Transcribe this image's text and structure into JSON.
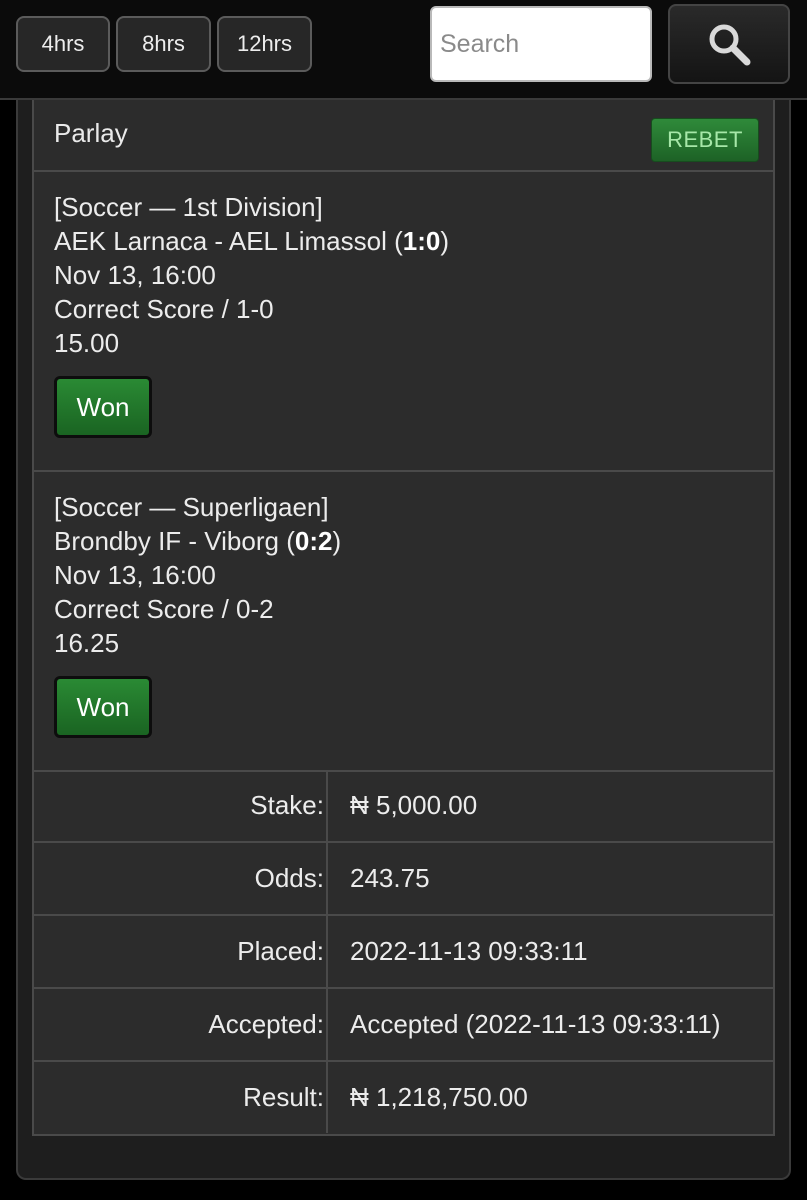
{
  "filters": {
    "buttons": [
      "4hrs",
      "8hrs",
      "12hrs"
    ]
  },
  "search": {
    "placeholder": "Search",
    "icon": "search-icon"
  },
  "bet": {
    "type_label": "Parlay",
    "rebet_label": "REBET",
    "selections": [
      {
        "league": "[Soccer — 1st Division]",
        "match": "AEK Larnaca - AEL Limassol",
        "score": "1:0",
        "datetime": "Nov 13, 16:00",
        "market": "Correct Score / 1-0",
        "odds": "15.00",
        "status": "Won"
      },
      {
        "league": "[Soccer — Superligaen]",
        "match": "Brondby IF - Viborg",
        "score": "0:2",
        "datetime": "Nov 13, 16:00",
        "market": "Correct Score / 0-2",
        "odds": "16.25",
        "status": "Won"
      }
    ],
    "details": [
      {
        "label": "Stake:",
        "value": "₦ 5,000.00"
      },
      {
        "label": "Odds:",
        "value": "243.75"
      },
      {
        "label": "Placed:",
        "value": "2022-11-13 09:33:11"
      },
      {
        "label": "Accepted:",
        "value": "Accepted (2022-11-13 09:33:11)"
      },
      {
        "label": "Result:",
        "value": "₦ 1,218,750.00"
      }
    ]
  },
  "colors": {
    "won_green": "#2a8a34",
    "rebet_green": "#2f8a3a",
    "card_bg": "#2c2c2c",
    "page_bg": "#000000"
  }
}
